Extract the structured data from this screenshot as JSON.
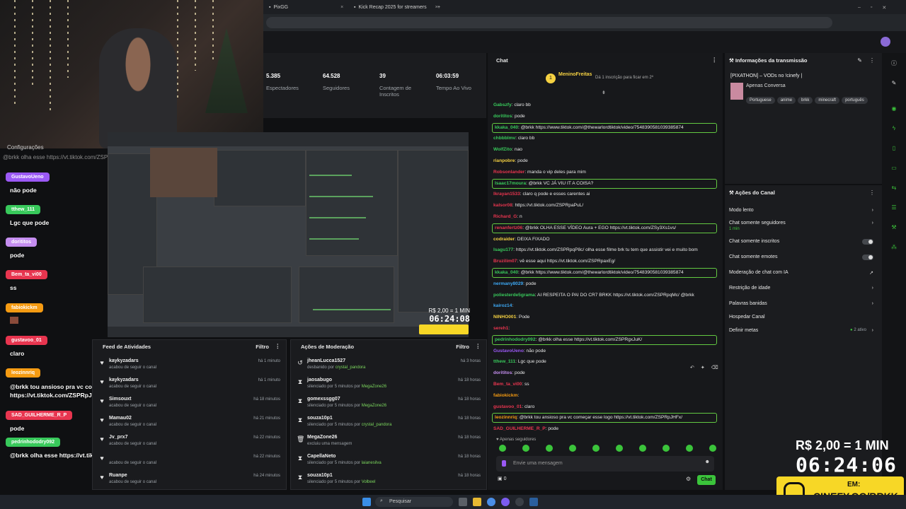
{
  "browser": {
    "tabs": [
      {
        "label": "PixGG"
      },
      {
        "label": "Kick Recap 2025 for streamers"
      }
    ],
    "new_tab": "+"
  },
  "left_chat": {
    "settings_label": "Configurações",
    "overlay_line": "@brkk olha esse https://vt.tiktok.com/ZSPRgxJuK/",
    "entries": [
      {
        "name": "GustavoUeno",
        "color": "#9b59f5",
        "msg": "não pode"
      },
      {
        "name": "tthew_111",
        "color": "#38c95b",
        "msg": "Lgc que pode"
      },
      {
        "name": "dorititos",
        "color": "#c58ef0",
        "msg": "pode"
      },
      {
        "name": "Bem_ta_vi00",
        "color": "#e8354f",
        "msg": "ss"
      },
      {
        "name": "fabiokickm",
        "color": "#f59b12",
        "msg": ""
      },
      {
        "name": "gustavoo_01",
        "color": "#e8354f",
        "msg": "claro"
      },
      {
        "name": "leozinnriq",
        "color": "#f59b12",
        "msg": "@brkk tou ansioso pra vc começar esse logo https://vt.tiktok.com/ZSPRpJHFx/"
      },
      {
        "name": "SAD_GUILHERME_R_P",
        "color": "#e8354f",
        "msg": "pode"
      },
      {
        "name": "pedrinhododry092",
        "color": "#38c95b",
        "msg": "@brkk olha esse https://vt.tiktok.com/ZSPRgxJuK/"
      }
    ]
  },
  "stats": [
    {
      "value": "5.385",
      "label": "Espectadores"
    },
    {
      "value": "64.528",
      "label": "Seguidores"
    },
    {
      "value": "39",
      "label": "Contagem de Inscritos"
    },
    {
      "value": "06:03:59",
      "label": "Tempo Ao Vivo"
    }
  ],
  "preview_timer": {
    "price": "R$ 2,00 = 1 MIN",
    "time": "06:24:08"
  },
  "activity_feed": {
    "title": "Feed de Atividades",
    "filter": "Filtro",
    "rows": [
      {
        "icon": "heart-icon",
        "name": "kaykyzadars",
        "sub": "acabou de seguir o canal",
        "time": "há 1 minuto"
      },
      {
        "icon": "heart-icon",
        "name": "kaykyzadars",
        "sub": "acabou de seguir o canal",
        "time": "há 1 minuto"
      },
      {
        "icon": "heart-icon",
        "name": "Simsouxt",
        "sub": "acabou de seguir o canal",
        "time": "há 18 minutos"
      },
      {
        "icon": "heart-icon",
        "name": "Mamau02",
        "sub": "acabou de seguir o canal",
        "time": "há 21 minutos"
      },
      {
        "icon": "heart-icon",
        "name": "Jv_prx7",
        "sub": "acabou de seguir o canal",
        "time": "há 22 minutos"
      },
      {
        "icon": "heart-icon",
        "name": "",
        "sub": "acabou de seguir o canal",
        "time": "há 22 minutos"
      },
      {
        "icon": "heart-icon",
        "name": "Ruanpe",
        "sub": "acabou de seguir o canal",
        "time": "há 24 minutos"
      }
    ]
  },
  "mod_actions": {
    "title": "Ações de Moderação",
    "filter": "Filtro",
    "rows": [
      {
        "icon": "undo-icon",
        "name": "jheanLucca1527",
        "sub": "desbanido por",
        "by": "crystal_pandora",
        "time": "há 3 horas"
      },
      {
        "icon": "hourglass-icon",
        "name": "jaosabugo",
        "sub": "silenciado por 5 minutos por",
        "by": "MegaZone26",
        "time": "há 18 horas"
      },
      {
        "icon": "hourglass-icon",
        "name": "gomexssgg07",
        "sub": "silenciado por 5 minutos por",
        "by": "MegaZone26",
        "time": "há 18 horas"
      },
      {
        "icon": "hourglass-icon",
        "name": "souza10p1",
        "sub": "silenciado por 5 minutos por",
        "by": "crystal_pandora",
        "time": "há 18 horas"
      },
      {
        "icon": "trash-icon",
        "name": "MegaZone26",
        "sub": "excluiu uma mensagem",
        "by": "",
        "time": "há 18 horas"
      },
      {
        "icon": "hourglass-icon",
        "name": "CapellaNeto",
        "sub": "silenciado por 5 minutos por",
        "by": "laianesilva",
        "time": "há 18 horas"
      },
      {
        "icon": "hourglass-icon",
        "name": "souza10p1",
        "sub": "silenciado por 5 minutos por",
        "by": "Volbeel",
        "time": "há 18 horas"
      }
    ]
  },
  "chat": {
    "title": "Chat",
    "pinned_user": "MeninoFreitas",
    "pinned_note": "Dá 1 inscrição para ficar em 2º",
    "messages": [
      {
        "user": "Gabszfy",
        "color": "#38c95b",
        "text": "claro bb",
        "hl": false
      },
      {
        "user": "dorititos",
        "color": "#38c95b",
        "text": "pode",
        "hl": false
      },
      {
        "user": "kkaka_040",
        "color": "#38c95b",
        "text": "@brkk https://www.tiktok.com/@thewarlordtiktok/video/7548390581039385874",
        "hl": true
      },
      {
        "user": "chbbblmv",
        "color": "#38c95b",
        "text": "claro bb",
        "hl": false
      },
      {
        "user": "WolfZito",
        "color": "#38c95b",
        "text": "nao",
        "hl": false
      },
      {
        "user": "rianpobre",
        "color": "#f5d142",
        "text": "pode",
        "hl": false
      },
      {
        "user": "Robsonlander",
        "color": "#e8354f",
        "text": "manda o vip deles para mim",
        "hl": false
      },
      {
        "user": "Isaac17moura",
        "color": "#38c95b",
        "text": "@brkk VC JÁ VIU IT A COISA?",
        "hl": true
      },
      {
        "user": "lkrayan1533",
        "color": "#e8354f",
        "text": "claro q pode e esses carentes ai",
        "hl": false
      },
      {
        "user": "kalsor08",
        "color": "#e8354f",
        "text": "https://vt.tiktok.com/ZSPRpaPuL/",
        "hl": false
      },
      {
        "user": "Richard_G",
        "color": "#e8354f",
        "text": "n",
        "hl": false
      },
      {
        "user": "renanfertz06",
        "color": "#e8354f",
        "text": "@brkk OLHA ESSE VÍDEO Aura + EGO https://vt.tiktok.com/ZSy3Xs1vs/",
        "hl": true
      },
      {
        "user": "codraider",
        "color": "#f5d142",
        "text": "DEIXA FIXADO",
        "hl": false
      },
      {
        "user": "Isagu177",
        "color": "#38c95b",
        "text": "https://vt.tiktok.com/ZSPRpqP8c/ olha esse filme brk tu tem que assistir vei e muito bom",
        "hl": false
      },
      {
        "user": "Bruzilim07",
        "color": "#e8354f",
        "text": "vê esse aqui https://vt.tiktok.com/ZSPRpaxEg/",
        "hl": false
      },
      {
        "user": "kkaka_040",
        "color": "#38c95b",
        "text": "@brkk https://www.tiktok.com/@thewarlordtiktok/video/7548390581039385874",
        "hl": true
      },
      {
        "user": "nermany8029",
        "color": "#3da9f5",
        "text": "pode",
        "hl": false
      },
      {
        "user": "poliesterde5grama",
        "color": "#38c95b",
        "text": "AI RESPEITA O PAI DO CR7 BRKK https://vt.tiktok.com/ZSPRpqMc/ @brkk",
        "hl": false
      },
      {
        "user": "kairoz14",
        "color": "#3da9f5",
        "text": "",
        "hl": false
      },
      {
        "user": "NINHO001",
        "color": "#f5d142",
        "text": "Pode",
        "hl": false
      },
      {
        "user": "sereh1",
        "color": "#e8354f",
        "text": "",
        "hl": false
      },
      {
        "user": "pedrinhododry092",
        "color": "#38c95b",
        "text": "@brkk olha esse https://vt.tiktok.com/ZSPRgxJuK/",
        "hl": true
      },
      {
        "user": "GustavoUeno",
        "color": "#9b59f5",
        "text": "não pode",
        "hl": false
      },
      {
        "user": "tthew_111",
        "color": "#38c95b",
        "text": "Lgc que pode",
        "hl": false
      },
      {
        "user": "dorititos",
        "color": "#c58ef0",
        "text": "pode",
        "hl": false
      },
      {
        "user": "Bem_ta_vi00",
        "color": "#e8354f",
        "text": "ss",
        "hl": false
      },
      {
        "user": "fabiokickm",
        "color": "#f59b12",
        "text": "",
        "hl": false
      },
      {
        "user": "gustavoo_01",
        "color": "#e8354f",
        "text": "claro",
        "hl": false
      },
      {
        "user": "leozinnriq",
        "color": "#f59b12",
        "text": "@brkk tou ansioso pra vc começar esse logo https://vt.tiktok.com/ZSPRpJHFx/",
        "hl": true
      },
      {
        "user": "SAD_GUILHERME_R_P",
        "color": "#e8354f",
        "text": "pode",
        "hl": false
      }
    ],
    "followers_only": "Apenas seguidores",
    "input_placeholder": "Envie uma mensagem",
    "count": "0",
    "send_label": "Chat"
  },
  "stream_info": {
    "title": "Informações da transmissão",
    "stream_title": "[PIXATHON] – VODs no !cinefy |",
    "category": "Apenas Conversa",
    "tags": [
      "Portuguese",
      "anime",
      "brkk",
      "minecraft",
      "português"
    ]
  },
  "channel_actions": {
    "title": "Ações do Canal",
    "items": [
      {
        "label": "Modo lento",
        "control": "chevron",
        "extra": ""
      },
      {
        "label": "Chat somente seguidores",
        "control": "chevron",
        "extra": "1 min"
      },
      {
        "label": "Chat somente inscritos",
        "control": "toggle",
        "extra": ""
      },
      {
        "label": "Chat somente emotes",
        "control": "toggle",
        "extra": ""
      },
      {
        "label": "Moderação de chat com IA",
        "control": "external",
        "extra": ""
      },
      {
        "label": "Restrição de idade",
        "control": "chevron",
        "extra": ""
      },
      {
        "label": "Palavras banidas",
        "control": "chevron",
        "extra": ""
      },
      {
        "label": "Hospedar Canal",
        "control": "none",
        "extra": ""
      },
      {
        "label": "Definir metas",
        "control": "chevron",
        "extra": "2 ativo"
      }
    ]
  },
  "overlay_timer": {
    "price": "R$ 2,00 = 1 MIN",
    "time": "06:24:06"
  },
  "promo": {
    "em": "EM:",
    "url": "CINEFY.GG/BRKK"
  },
  "taskbar": {
    "search_placeholder": "Pesquisar"
  }
}
